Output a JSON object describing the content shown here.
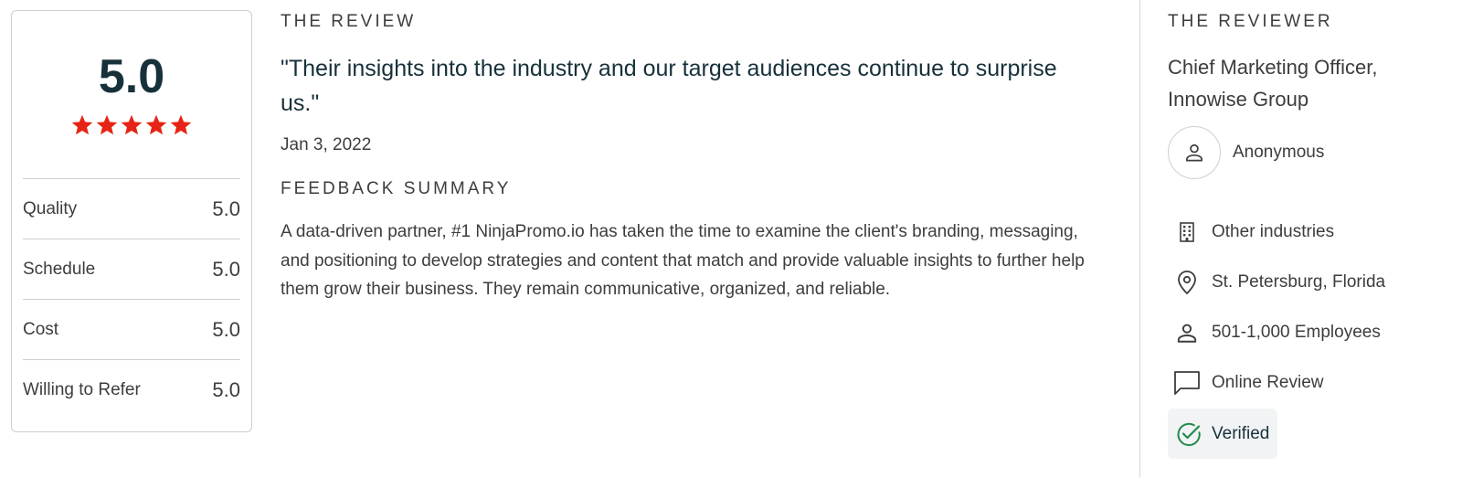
{
  "rating_card": {
    "overall": "5.0",
    "stars": 5,
    "star_color": "#e62415",
    "metrics": [
      {
        "label": "Quality",
        "value": "5.0"
      },
      {
        "label": "Schedule",
        "value": "5.0"
      },
      {
        "label": "Cost",
        "value": "5.0"
      },
      {
        "label": "Willing to Refer",
        "value": "5.0"
      }
    ]
  },
  "review": {
    "section_title": "THE REVIEW",
    "quote": "\"Their insights into the industry and our target audiences continue to surprise us.\"",
    "date": "Jan 3, 2022",
    "feedback_title": "FEEDBACK SUMMARY",
    "summary": "A data-driven partner, #1 NinjaPromo.io has taken the time to examine the client's branding, messaging, and positioning to develop strategies and content that match and provide valuable insights to further help them grow their business. They remain communicative, organized, and reliable."
  },
  "reviewer": {
    "section_title": "THE REVIEWER",
    "title": "Chief Marketing Officer, Innowise Group",
    "name": "Anonymous",
    "industry": "Other industries",
    "location": "St. Petersburg, Florida",
    "company_size": "501-1,000 Employees",
    "review_type": "Online Review",
    "verified_label": "Verified",
    "verified_color": "#1f8a4c"
  },
  "icons": {
    "star": "star-icon",
    "avatar": "person-icon",
    "industry": "building-icon",
    "location": "location-pin-icon",
    "size": "person-icon",
    "review_type": "chat-bubble-icon",
    "verified": "check-circle-icon"
  }
}
